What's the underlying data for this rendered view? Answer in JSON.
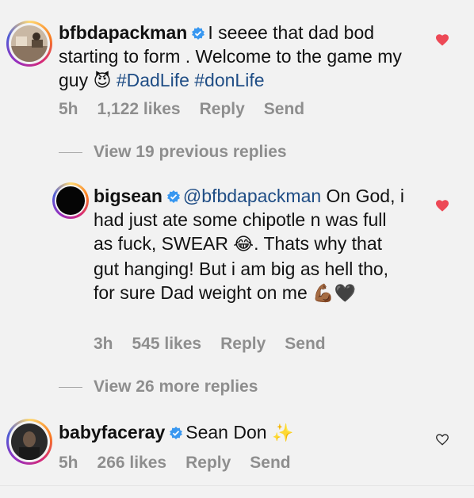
{
  "comments": [
    {
      "username": "bfbdapackman",
      "text_before": "I seeee that dad bod starting to form . Welcome to the game my guy",
      "emoji": "😈",
      "hashtags": "#DadLife #donLife",
      "time": "5h",
      "likes": "1,122 likes",
      "reply": "Reply",
      "send": "Send",
      "liked": true
    },
    {
      "username": "bigsean",
      "mention": "@bfbdapackman",
      "text": "On God, i had just ate some chipotle n was full as fuck, SWEAR",
      "emoji1": "😂",
      "text2": ". Thats why that gut hanging! But i am big as hell tho, for sure Dad weight on me",
      "emoji2": "💪🏾🖤",
      "time": "3h",
      "likes": "545 likes",
      "reply": "Reply",
      "send": "Send",
      "liked": true
    },
    {
      "username": "babyfaceray",
      "text": "Sean Don",
      "emoji": "✨",
      "time": "5h",
      "likes": "266 likes",
      "reply": "Reply",
      "send": "Send",
      "liked": false
    }
  ],
  "view_previous": "View 19 previous replies",
  "view_more": "View 26 more replies",
  "colors": {
    "heart_liked": "#ed4956",
    "hashtag": "#1f4d85",
    "verified": "#3897f0",
    "meta": "#8e8e8e"
  }
}
